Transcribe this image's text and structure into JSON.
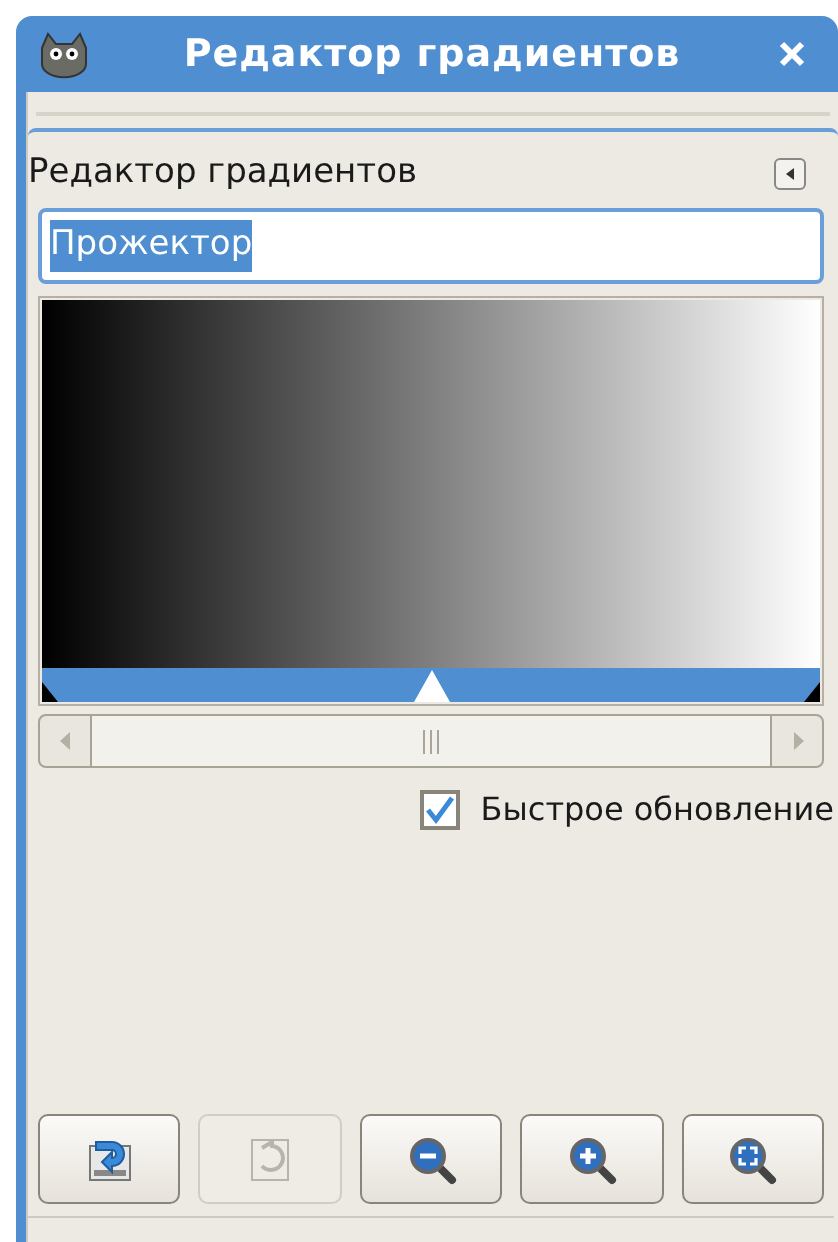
{
  "window": {
    "title": "Редактор градиентов"
  },
  "panel": {
    "title": "Редактор градиентов"
  },
  "name_field": {
    "value": "Прожектор",
    "selected": true
  },
  "midpoint": {
    "level": 0.5
  },
  "fast_update": {
    "label": "Быстрое обновление",
    "checked": true
  },
  "buttons": [
    {
      "kind": "save",
      "disabled": false
    },
    {
      "kind": "revert",
      "disabled": true
    },
    {
      "kind": "zoom-out",
      "disabled": false
    },
    {
      "kind": "zoom-in",
      "disabled": false
    },
    {
      "kind": "zoom-fit",
      "disabled": false
    }
  ]
}
